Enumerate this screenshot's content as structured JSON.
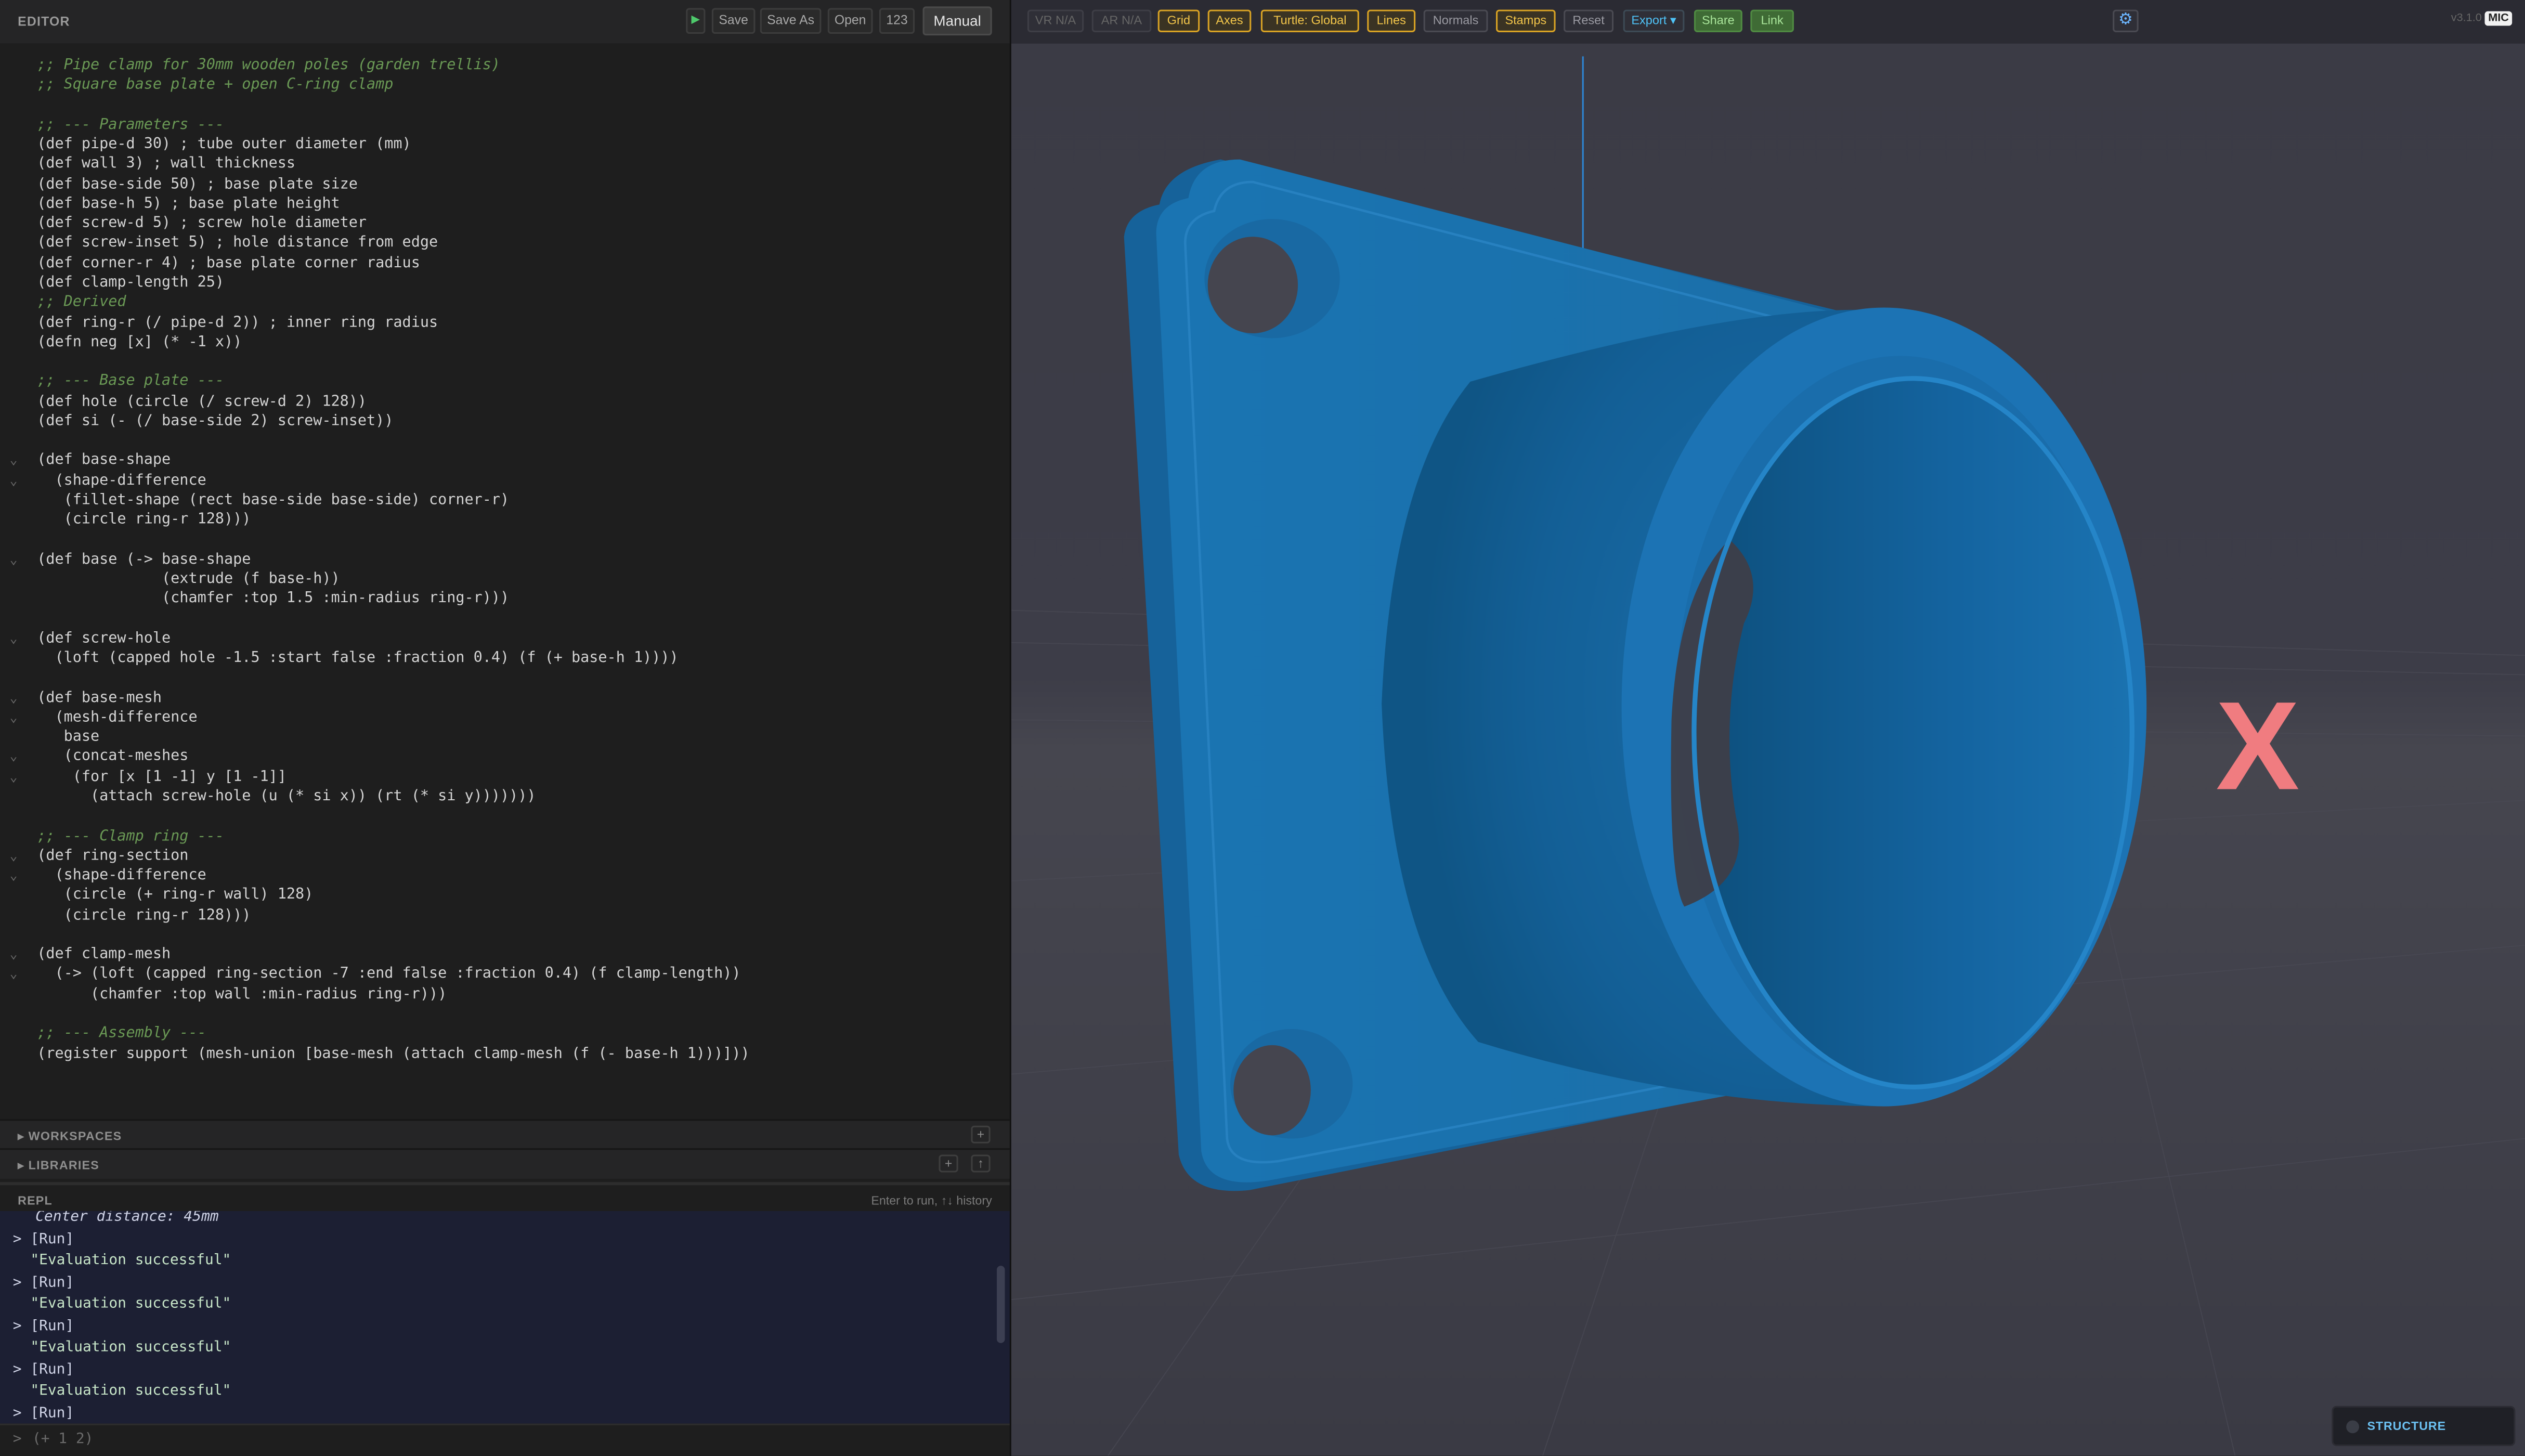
{
  "editor": {
    "title": "EDITOR",
    "run_icon": "play-icon",
    "buttons": {
      "save": "Save",
      "save_as": "Save As",
      "open": "Open",
      "numbers": "123"
    },
    "mode": "Manual"
  },
  "code_lines": [
    {
      "t": ";; Pipe clamp for 30mm wooden poles (garden trellis)",
      "cls": "c"
    },
    {
      "t": ";; Square base plate + open C-ring clamp",
      "cls": "c"
    },
    {
      "t": "",
      "cls": ""
    },
    {
      "t": ";; --- Parameters ---",
      "cls": "c"
    },
    {
      "t": "(def pipe-d 30) ; tube outer diameter (mm)",
      "cls": ""
    },
    {
      "t": "(def wall 3) ; wall thickness",
      "cls": ""
    },
    {
      "t": "(def base-side 50) ; base plate size",
      "cls": ""
    },
    {
      "t": "(def base-h 5) ; base plate height",
      "cls": ""
    },
    {
      "t": "(def screw-d 5) ; screw hole diameter",
      "cls": ""
    },
    {
      "t": "(def screw-inset 5) ; hole distance from edge",
      "cls": ""
    },
    {
      "t": "(def corner-r 4) ; base plate corner radius",
      "cls": ""
    },
    {
      "t": "(def clamp-length 25)",
      "cls": ""
    },
    {
      "t": ";; Derived",
      "cls": "c"
    },
    {
      "t": "(def ring-r (/ pipe-d 2)) ; inner ring radius",
      "cls": ""
    },
    {
      "t": "(defn neg [x] (* -1 x))",
      "cls": ""
    },
    {
      "t": "",
      "cls": ""
    },
    {
      "t": ";; --- Base plate ---",
      "cls": "c"
    },
    {
      "t": "(def hole (circle (/ screw-d 2) 128))",
      "cls": ""
    },
    {
      "t": "(def si (- (/ base-side 2) screw-inset))",
      "cls": ""
    },
    {
      "t": "",
      "cls": ""
    },
    {
      "t": "(def base-shape",
      "cls": "",
      "fold": true
    },
    {
      "t": "  (shape-difference",
      "cls": "",
      "fold": true
    },
    {
      "t": "   (fillet-shape (rect base-side base-side) corner-r)",
      "cls": ""
    },
    {
      "t": "   (circle ring-r 128)))",
      "cls": ""
    },
    {
      "t": "",
      "cls": ""
    },
    {
      "t": "(def base (-> base-shape",
      "cls": "",
      "fold": true
    },
    {
      "t": "              (extrude (f base-h))",
      "cls": ""
    },
    {
      "t": "              (chamfer :top 1.5 :min-radius ring-r)))",
      "cls": ""
    },
    {
      "t": "",
      "cls": ""
    },
    {
      "t": "(def screw-hole",
      "cls": "",
      "fold": true
    },
    {
      "t": "  (loft (capped hole -1.5 :start false :fraction 0.4) (f (+ base-h 1))))",
      "cls": ""
    },
    {
      "t": "",
      "cls": ""
    },
    {
      "t": "(def base-mesh",
      "cls": "",
      "fold": true
    },
    {
      "t": "  (mesh-difference",
      "cls": "",
      "fold": true
    },
    {
      "t": "   base",
      "cls": ""
    },
    {
      "t": "   (concat-meshes",
      "cls": "",
      "fold": true
    },
    {
      "t": "    (for [x [1 -1] y [1 -1]]",
      "cls": "",
      "fold": true
    },
    {
      "t": "      (attach screw-hole (u (* si x)) (rt (* si y)))))))",
      "cls": ""
    },
    {
      "t": "",
      "cls": ""
    },
    {
      "t": ";; --- Clamp ring ---",
      "cls": "c"
    },
    {
      "t": "(def ring-section",
      "cls": "",
      "fold": true
    },
    {
      "t": "  (shape-difference",
      "cls": "",
      "fold": true
    },
    {
      "t": "   (circle (+ ring-r wall) 128)",
      "cls": ""
    },
    {
      "t": "   (circle ring-r 128)))",
      "cls": ""
    },
    {
      "t": "",
      "cls": ""
    },
    {
      "t": "(def clamp-mesh",
      "cls": "",
      "fold": true
    },
    {
      "t": "  (-> (loft (capped ring-section -7 :end false :fraction 0.4) (f clamp-length))",
      "cls": "",
      "fold": true
    },
    {
      "t": "      (chamfer :top wall :min-radius ring-r)))",
      "cls": ""
    },
    {
      "t": "",
      "cls": ""
    },
    {
      "t": ";; --- Assembly ---",
      "cls": "c"
    },
    {
      "t": "(register support (mesh-union [base-mesh (attach clamp-mesh (f (- base-h 1)))]))",
      "cls": ""
    }
  ],
  "panels": {
    "workspaces": "WORKSPACES",
    "libraries": "LIBRARIES"
  },
  "repl": {
    "title": "REPL",
    "hint": "Enter to run, ↑↓ history",
    "lines": [
      {
        "t": "Center distance: 45mm",
        "cls": "c"
      },
      {
        "t": "> [Run]",
        "cls": ""
      },
      {
        "t": "  \"Evaluation successful\"",
        "cls": "rstr"
      },
      {
        "t": "> [Run]",
        "cls": ""
      },
      {
        "t": "  \"Evaluation successful\"",
        "cls": "rstr"
      },
      {
        "t": "> [Run]",
        "cls": ""
      },
      {
        "t": "  \"Evaluation successful\"",
        "cls": "rstr"
      },
      {
        "t": "> [Run]",
        "cls": ""
      },
      {
        "t": "  \"Evaluation successful\"",
        "cls": "rstr"
      },
      {
        "t": "> [Run]",
        "cls": ""
      }
    ],
    "prompt": ">",
    "placeholder": "(+ 1 2)"
  },
  "viewport": {
    "buttons": [
      "VR N/A",
      "AR N/A",
      "Grid",
      "Axes",
      "Turtle: Global",
      "Lines",
      "Normals",
      "Stamps",
      "Reset",
      "Export ▾",
      "Share",
      "Link"
    ],
    "gear_icon": "gear-icon",
    "version": "v3.1.0",
    "mic": "MIC",
    "structure": "STRUCTURE",
    "model_color": "#1f77b4",
    "marker": "X"
  }
}
